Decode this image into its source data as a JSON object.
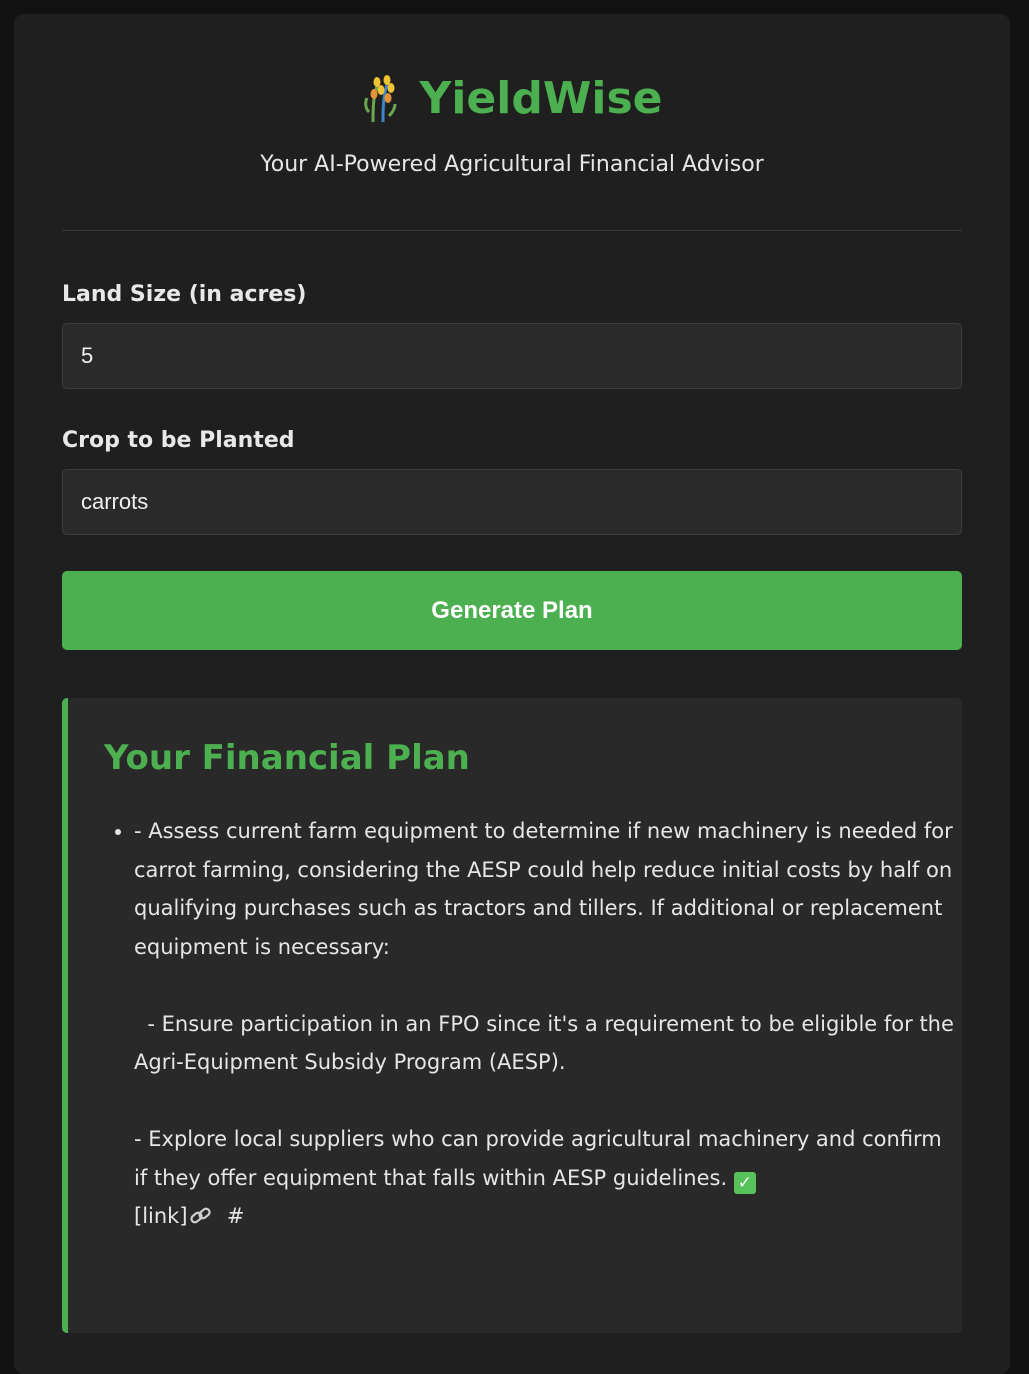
{
  "brand": {
    "icon": "wheat-icon",
    "name": "YieldWise",
    "tagline": "Your AI-Powered Agricultural Financial Advisor"
  },
  "form": {
    "land_size": {
      "label": "Land Size (in acres)",
      "value": "5"
    },
    "crop": {
      "label": "Crop to be Planted",
      "value": "carrots"
    },
    "submit_label": "Generate Plan"
  },
  "result": {
    "title": "Your Financial Plan",
    "item_text": "- Assess current farm equipment to determine if new machinery is needed for carrot farming, considering the AESP could help reduce initial costs by half on qualifying purchases such as tractors and tillers. If additional or replacement equipment is necessary:\n\n  - Ensure participation in an FPO since it's a requirement to be eligible for the Agri-Equipment Subsidy Program (AESP).\n\n- Explore local suppliers who can provide agricultural machinery and confirm if they offer equipment that falls within AESP guidelines.",
    "check_icon": "check-mark-icon",
    "link_text": "[link]",
    "link_icon": "link-icon",
    "hash_text": "#"
  },
  "colors": {
    "accent": "#4caf50",
    "background": "#1f1f1f",
    "page": "#111111"
  }
}
